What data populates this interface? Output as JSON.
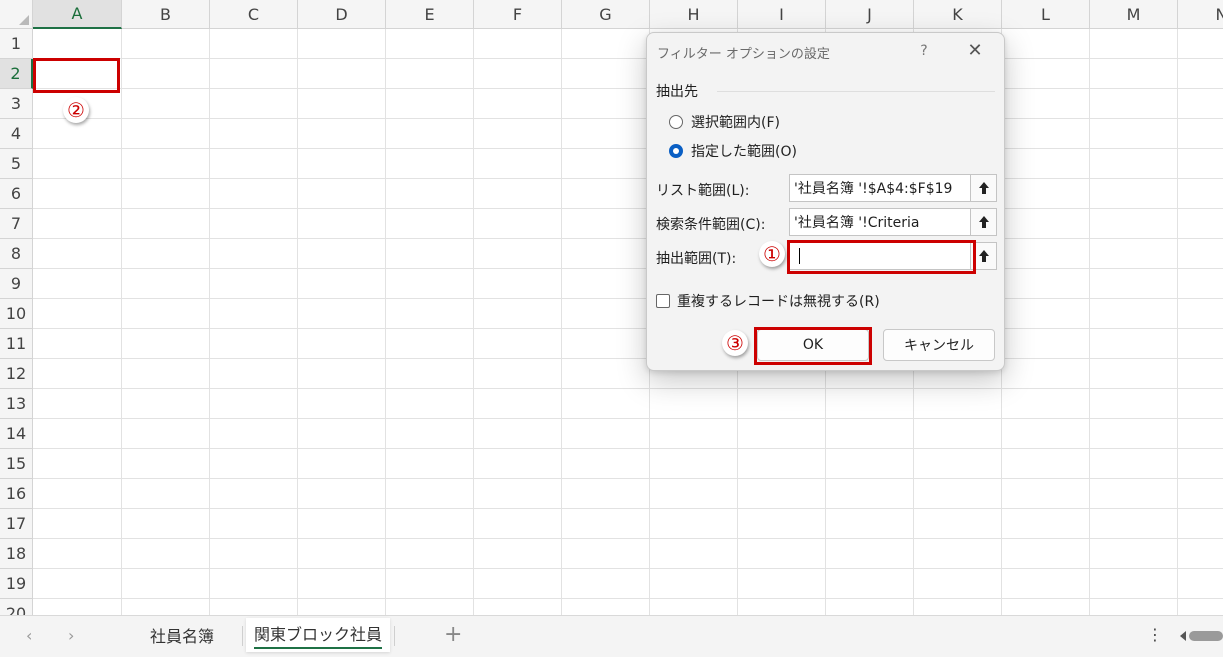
{
  "sheet": {
    "columns": [
      "A",
      "B",
      "C",
      "D",
      "E",
      "F",
      "G",
      "H",
      "I",
      "J",
      "K",
      "L",
      "M",
      "N"
    ],
    "rows": [
      "1",
      "2",
      "3",
      "4",
      "5",
      "6",
      "7",
      "8",
      "9",
      "10",
      "11",
      "12",
      "13",
      "14",
      "15",
      "16",
      "17",
      "18",
      "19",
      "20"
    ],
    "selected_column": "A",
    "selected_row": "2"
  },
  "markers": {
    "one": "①",
    "two": "②",
    "three": "③"
  },
  "dialog": {
    "title": "フィルター オプションの設定",
    "help": "?",
    "close": "✕",
    "extract_section": "抽出先",
    "radio_in_place": "選択範囲内(F)",
    "radio_other_range": "指定した範囲(O)",
    "selected_radio": "指定した範囲(O)",
    "list_range_label": "リスト範囲(L):",
    "list_range_value": "'社員名簿 '!$A$4:$F$19",
    "criteria_range_label": "検索条件範囲(C):",
    "criteria_range_value": "'社員名簿 '!Criteria",
    "copy_to_label": "抽出範囲(T):",
    "copy_to_value": "",
    "unique_only_label": "重複するレコードは無視する(R)",
    "unique_only_checked": false,
    "ok_button": "OK",
    "cancel_button": "キャンセル"
  },
  "tabs": {
    "prev": "‹",
    "next": "›",
    "items": [
      "社員名簿",
      "関東ブロック社員"
    ],
    "active": "関東ブロック社員",
    "add": "+",
    "more": "⋮"
  },
  "colors": {
    "accent_green": "#1e7145",
    "annotation_red": "#cc0000",
    "radio_blue": "#0a5fc4"
  }
}
